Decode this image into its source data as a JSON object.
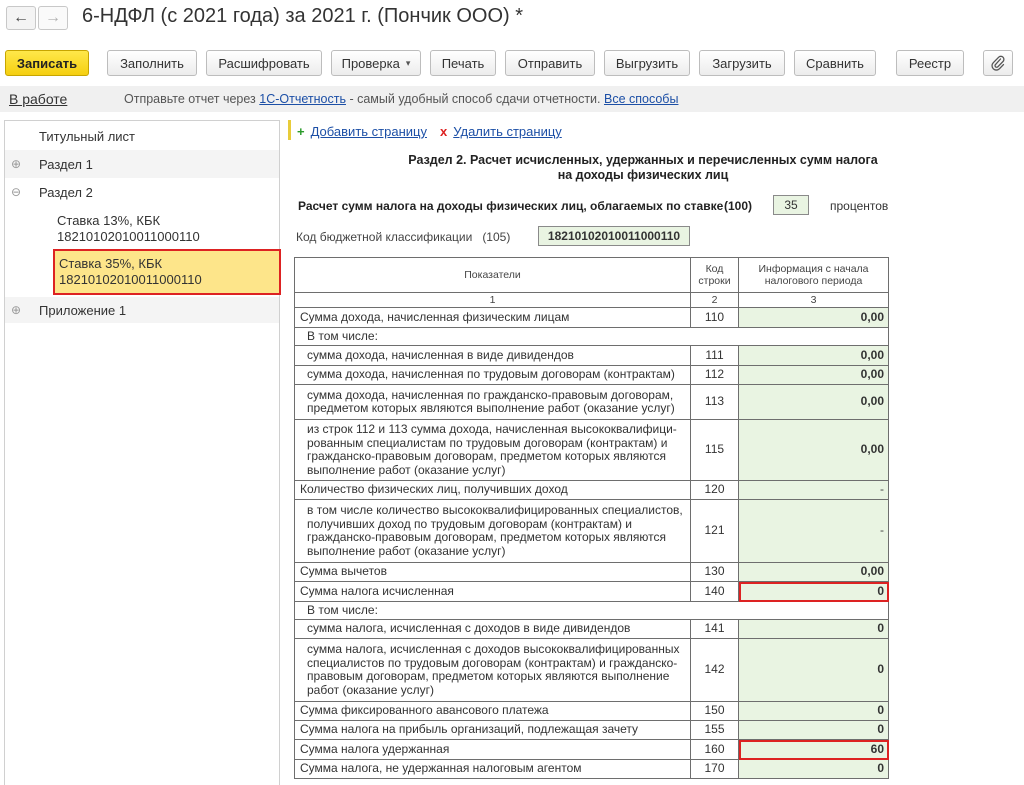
{
  "window": {
    "title": "6-НДФЛ (с 2021 года) за 2021 г. (Пончик ООО) *",
    "back_icon": "←",
    "forward_icon": "→"
  },
  "toolbar": {
    "save_label": "Записать",
    "fill_label": "Заполнить",
    "decode_label": "Расшифровать",
    "check_label": "Проверка",
    "print_label": "Печать",
    "send_label": "Отправить",
    "export_label": "Выгрузить",
    "import_label": "Загрузить",
    "compare_label": "Сравнить",
    "registry_label": "Реестр",
    "attach_icon": "paperclip-icon",
    "dropdown_caret": "▾",
    "accent_color": "#f5cf10"
  },
  "infobar": {
    "status": "В работе",
    "text_before": "Отправьте отчет через ",
    "service_link": "1С-Отчетность",
    "text_after": " - самый удобный способ сдачи отчетности. ",
    "all_methods_link": "Все способы"
  },
  "tree": {
    "expand_icon": "⊕",
    "collapse_icon": "⊖",
    "items": [
      {
        "label": "Титульный лист"
      },
      {
        "label": "Раздел 1"
      },
      {
        "label": "Раздел 2"
      },
      {
        "label": "Ставка 13%, КБК",
        "kbk": "18210102010011000110"
      },
      {
        "label": "Ставка 35%, КБК",
        "kbk": "18210102010011000110"
      },
      {
        "label": "Приложение 1"
      }
    ]
  },
  "page_actions": {
    "add_symbol": "+",
    "add_label": "Добавить страницу",
    "delete_symbol": "x",
    "delete_label": "Удалить страницу"
  },
  "section": {
    "title_line1": "Раздел 2. Расчет исчисленных, удержанных и перечисленных сумм налога",
    "title_line2": "на доходы физических лиц",
    "rate_label": "Расчет сумм налога на доходы физических лиц, облагаемых по ставке",
    "rate_code": "(100)",
    "rate_value": "35",
    "rate_unit": "процентов",
    "kbk_label": "Код бюджетной классификации",
    "kbk_code": "(105)",
    "kbk_value": "18210102010011000110"
  },
  "table": {
    "headers": {
      "indicators": "Показатели",
      "line_code": "Код строки",
      "info": "Информация с начала налогового периода",
      "n1": "1",
      "n2": "2",
      "n3": "3"
    },
    "rows": [
      {
        "label": "Сумма дохода, начисленная физическим лицам",
        "code": "110",
        "value": "0,00"
      },
      {
        "label": "В том числе:"
      },
      {
        "label": "сумма дохода, начисленная в виде дивидендов",
        "code": "111",
        "value": "0,00"
      },
      {
        "label": "сумма дохода, начисленная по трудовым договорам (контрактам)",
        "code": "112",
        "value": "0,00"
      },
      {
        "label": "сумма дохода, начисленная по гражданско-правовым договорам, предметом которых являются выполнение работ (оказание услуг)",
        "code": "113",
        "value": "0,00"
      },
      {
        "label": "из строк 112 и 113 сумма дохода, начисленная высококвалифици-рованным специалистам по трудовым договорам (контрактам) и гражданско-правовым договорам, предметом которых являются выполнение работ (оказание услуг)",
        "code": "115",
        "value": "0,00"
      },
      {
        "label": "Количество физических лиц, получивших доход",
        "code": "120",
        "value": "-"
      },
      {
        "label": "в том числе количество высококвалифицированных специалистов, получивших доход по трудовым договорам (контрактам) и гражданско-правовым договорам, предметом которых являются выполнение работ (оказание услуг)",
        "code": "121",
        "value": "-"
      },
      {
        "label": "Сумма вычетов",
        "code": "130",
        "value": "0,00"
      },
      {
        "label": "Сумма налога исчисленная",
        "code": "140",
        "value": "0"
      },
      {
        "label": "В том числе:"
      },
      {
        "label": "сумма налога, исчисленная с доходов в виде дивидендов",
        "code": "141",
        "value": "0"
      },
      {
        "label": "сумма налога, исчисленная с доходов высококвалифицированных специалистов по трудовым договорам (контрактам) и гражданско-правовым договорам, предметом которых являются выполнение работ (оказание услуг)",
        "code": "142",
        "value": "0"
      },
      {
        "label": "Сумма фиксированного авансового платежа",
        "code": "150",
        "value": "0"
      },
      {
        "label": "Сумма налога на прибыль организаций, подлежащая зачету",
        "code": "155",
        "value": "0"
      },
      {
        "label": "Сумма налога удержанная",
        "code": "160",
        "value": "60"
      },
      {
        "label": "Сумма налога, не удержанная налоговым агентом",
        "code": "170",
        "value": "0"
      }
    ]
  }
}
